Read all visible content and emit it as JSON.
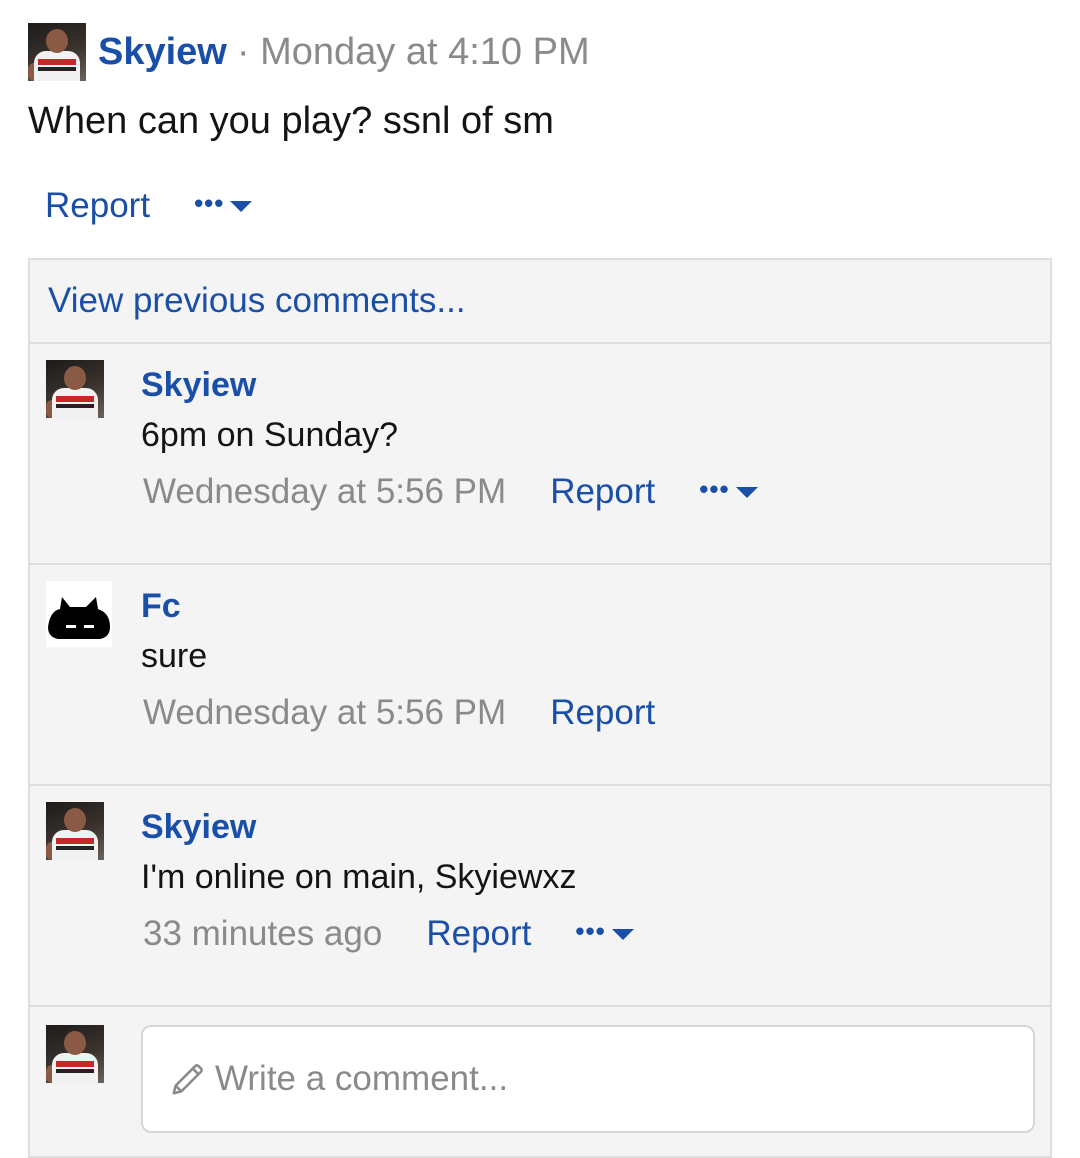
{
  "post": {
    "author": "Skyiew",
    "separator": "·",
    "time": "Monday at 4:10 PM",
    "body": "When can you play? ssnl of sm",
    "report_label": "Report",
    "more_dots": "•••"
  },
  "comments_section": {
    "view_previous": "View previous comments...",
    "comments": [
      {
        "author": "Skyiew",
        "text": "6pm on Sunday?",
        "time": "Wednesday at 5:56 PM",
        "report_label": "Report",
        "more_dots": "•••"
      },
      {
        "author": "Fc",
        "text": "sure",
        "time": "Wednesday at 5:56 PM",
        "report_label": "Report"
      },
      {
        "author": "Skyiew",
        "text": "I'm online on main, Skyiewxz",
        "time": "33 minutes ago",
        "report_label": "Report",
        "more_dots": "•••"
      }
    ],
    "reply_placeholder": "Write a comment..."
  },
  "colors": {
    "link": "#1a4fa8",
    "muted": "#8a8a8a",
    "panel": "#f4f4f4",
    "border": "#dedede"
  },
  "icons": [
    "user-avatar",
    "cat-avatar",
    "more-dots-icon",
    "caret-down-icon",
    "pencil-icon"
  ]
}
